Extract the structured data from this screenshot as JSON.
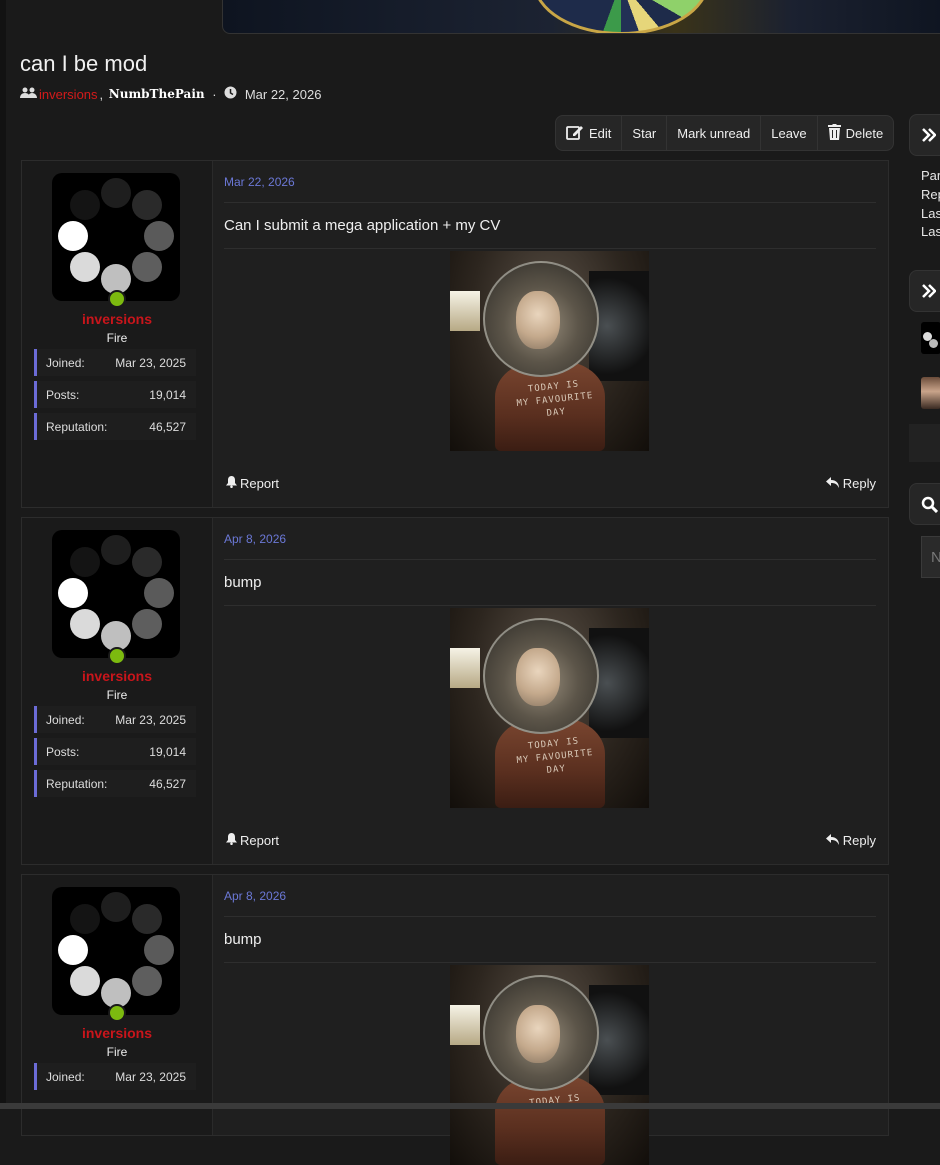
{
  "thread": {
    "title": "can I be mod",
    "participants": [
      "inversions",
      "NumbThePain"
    ],
    "separator": "·",
    "date": "Mar 22, 2026"
  },
  "toolbar": {
    "edit": "Edit",
    "star": "Star",
    "mark_unread": "Mark unread",
    "leave": "Leave",
    "delete": "Delete"
  },
  "posts": [
    {
      "date": "Mar 22, 2026",
      "text": "Can I submit a mega application + my CV",
      "user": {
        "name": "inversions",
        "title": "Fire"
      },
      "stats": [
        {
          "label": "Joined:",
          "value": "Mar 23, 2025"
        },
        {
          "label": "Posts:",
          "value": "19,014"
        },
        {
          "label": "Reputation:",
          "value": "46,527"
        }
      ],
      "image_text": [
        "TODAY IS",
        "MY FAVOURITE",
        "DAY"
      ],
      "report": "Report",
      "reply": "Reply"
    },
    {
      "date": "Apr 8, 2026",
      "text": "bump",
      "user": {
        "name": "inversions",
        "title": "Fire"
      },
      "stats": [
        {
          "label": "Joined:",
          "value": "Mar 23, 2025"
        },
        {
          "label": "Posts:",
          "value": "19,014"
        },
        {
          "label": "Reputation:",
          "value": "46,527"
        }
      ],
      "image_text": [
        "TODAY IS",
        "MY FAVOURITE",
        "DAY"
      ],
      "report": "Report",
      "reply": "Reply"
    },
    {
      "date": "Apr 8, 2026",
      "text": "bump",
      "user": {
        "name": "inversions",
        "title": "Fire"
      },
      "stats": [
        {
          "label": "Joined:",
          "value": "Mar 23, 2025"
        }
      ],
      "image_text": [
        "TODAY IS"
      ]
    }
  ],
  "sidebar": {
    "info_lines": [
      "Part",
      "Rep",
      "Last",
      "Last"
    ],
    "search_placeholder": "N"
  },
  "colors": {
    "username": "#c9151b",
    "date_link": "#6b78d6",
    "stat_accent": "#6b6bd6",
    "online": "#7cba0f"
  },
  "icons": {
    "participants": "users-icon",
    "date": "clock-icon",
    "edit": "edit-icon",
    "delete": "trash-icon",
    "report": "bell-icon",
    "reply": "reply-icon",
    "sidebar_toggle": "double-chevron-right-icon",
    "search": "search-icon"
  }
}
